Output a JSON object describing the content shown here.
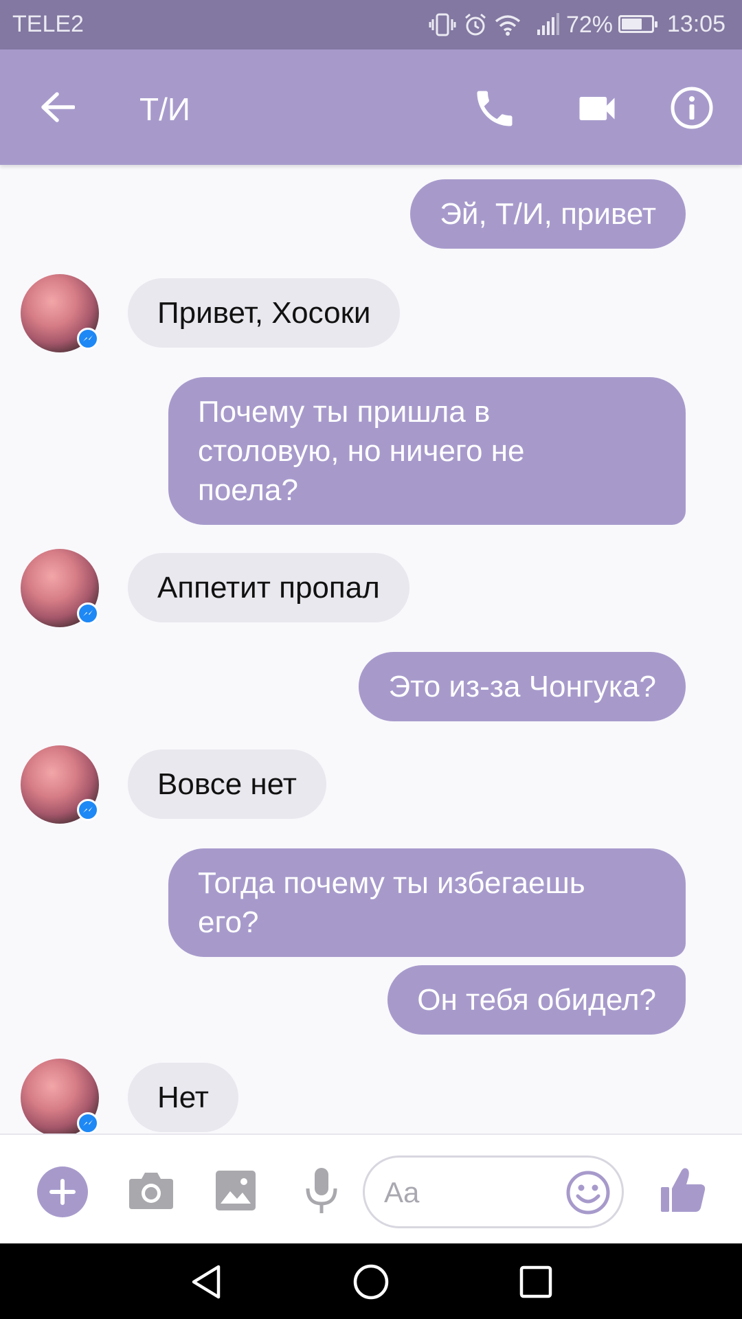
{
  "status_bar": {
    "carrier": "TELE2",
    "battery_percent": "72%",
    "battery_level": 0.72,
    "time": "13:05",
    "icons": [
      "vibrate-icon",
      "alarm-icon",
      "wifi-icon",
      "signal-icon",
      "battery-icon"
    ]
  },
  "header": {
    "title": "Т/И",
    "icons": [
      "back-arrow-icon",
      "phone-icon",
      "video-camera-icon",
      "info-icon"
    ]
  },
  "messages": [
    {
      "from": "me",
      "text": "Эй, Т/И, привет"
    },
    {
      "from": "them",
      "text": "Привет, Хосоки"
    },
    {
      "from": "me",
      "text": "Почему ты пришла в\nстоловую, но ничего не\nпоела?"
    },
    {
      "from": "them",
      "text": "Аппетит пропал"
    },
    {
      "from": "me",
      "text": "Это из-за Чонгука?"
    },
    {
      "from": "them",
      "text": "Вовсе нет"
    },
    {
      "from": "me",
      "text": "Тогда почему ты избегаешь\nего?"
    },
    {
      "from": "me",
      "text": "Он тебя обидел?"
    },
    {
      "from": "them",
      "text": "Нет"
    }
  ],
  "composer": {
    "placeholder": "Aa",
    "icons": [
      "plus-icon",
      "camera-icon",
      "image-icon",
      "microphone-icon",
      "emoji-icon",
      "thumbs-up-icon"
    ]
  },
  "colors": {
    "accent": "#a79acb",
    "status_bar": "#8278a1",
    "incoming_bubble": "#e9e8ee",
    "messenger_badge": "#1e88f5"
  },
  "nav_bar": {
    "icons": [
      "back-triangle-icon",
      "home-circle-icon",
      "recents-square-icon"
    ]
  }
}
